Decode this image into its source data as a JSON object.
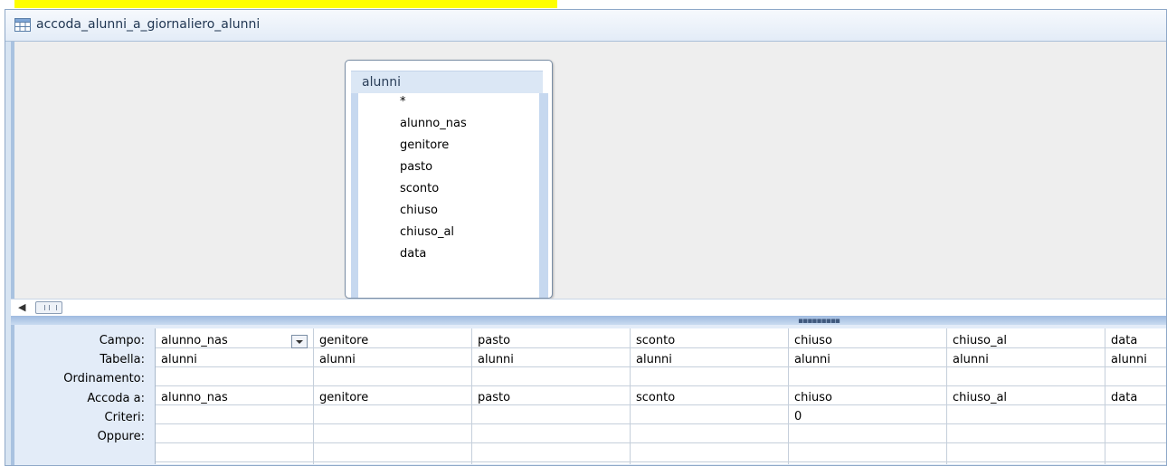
{
  "window": {
    "title": "accoda_alunni_a_giornaliero_alunni"
  },
  "table_box": {
    "name": "alunni",
    "fields": [
      "*",
      "alunno_nas",
      "genitore",
      "pasto",
      "sconto",
      "chiuso",
      "chiuso_al",
      "data"
    ]
  },
  "grid": {
    "row_labels": [
      "Campo:",
      "Tabella:",
      "Ordinamento:",
      "Accoda a:",
      "Criteri:",
      "Oppure:"
    ],
    "columns": [
      {
        "campo": "alunno_nas",
        "tabella": "alunni",
        "ordinamento": "",
        "accoda": "alunno_nas",
        "criteri": "",
        "oppure": ""
      },
      {
        "campo": "genitore",
        "tabella": "alunni",
        "ordinamento": "",
        "accoda": "genitore",
        "criteri": "",
        "oppure": ""
      },
      {
        "campo": "pasto",
        "tabella": "alunni",
        "ordinamento": "",
        "accoda": "pasto",
        "criteri": "",
        "oppure": ""
      },
      {
        "campo": "sconto",
        "tabella": "alunni",
        "ordinamento": "",
        "accoda": "sconto",
        "criteri": "",
        "oppure": ""
      },
      {
        "campo": "chiuso",
        "tabella": "alunni",
        "ordinamento": "",
        "accoda": "chiuso",
        "criteri": "0",
        "oppure": ""
      },
      {
        "campo": "chiuso_al",
        "tabella": "alunni",
        "ordinamento": "",
        "accoda": "chiuso_al",
        "criteri": "",
        "oppure": ""
      },
      {
        "campo": "data",
        "tabella": "alunni",
        "ordinamento": "",
        "accoda": "data",
        "criteri": "",
        "oppure": ""
      }
    ]
  },
  "icons": {
    "window_icon": "query-design-icon",
    "scroll_left": "scroll-left-arrow-icon",
    "dropdown": "chevron-down-icon"
  },
  "colors": {
    "highlight": "#ffff00",
    "frame": "#d7e4f2",
    "upper_pane": "#eeeeee",
    "lower_pane": "#e3ecf8",
    "splitter": "#9fbbe0"
  }
}
